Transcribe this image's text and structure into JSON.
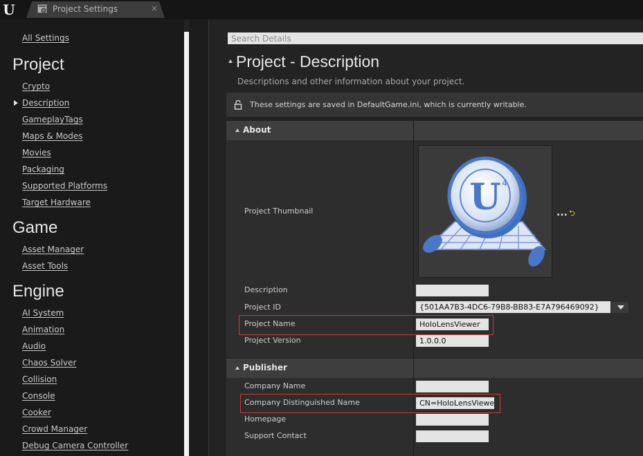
{
  "window": {
    "tab_title": "Project Settings",
    "tab_close": "×",
    "logo_text": "U"
  },
  "sidebar": {
    "all_settings": "All Settings",
    "sections": [
      {
        "heading": "Project",
        "items": [
          "Crypto",
          "Description",
          "GameplayTags",
          "Maps & Modes",
          "Movies",
          "Packaging",
          "Supported Platforms",
          "Target Hardware"
        ]
      },
      {
        "heading": "Game",
        "items": [
          "Asset Manager",
          "Asset Tools"
        ]
      },
      {
        "heading": "Engine",
        "items": [
          "AI System",
          "Animation",
          "Audio",
          "Chaos Solver",
          "Collision",
          "Console",
          "Cooker",
          "Crowd Manager",
          "Debug Camera Controller"
        ]
      }
    ],
    "selected_item": "Description"
  },
  "details": {
    "search_placeholder": "Search Details",
    "title": "Project - Description",
    "subtitle": "Descriptions and other information about your project.",
    "notice": "These settings are saved in DefaultGame.ini, which is currently writable.",
    "about": {
      "label": "About",
      "rows": {
        "thumbnail_label": "Project Thumbnail",
        "thumbnail_more": "...",
        "thumbnail_reset": "⮌",
        "description_label": "Description",
        "description_value": "",
        "project_id_label": "Project ID",
        "project_id_value": "{501AA7B3-4DC6-79B8-BB83-E7A796469092}",
        "project_name_label": "Project Name",
        "project_name_value": "HoloLensViewer",
        "project_version_label": "Project Version",
        "project_version_value": "1.0.0.0"
      }
    },
    "publisher": {
      "label": "Publisher",
      "rows": {
        "company_name_label": "Company Name",
        "company_name_value": "",
        "company_dn_label": "Company Distinguished Name",
        "company_dn_value": "CN=HoloLensViewer",
        "homepage_label": "Homepage",
        "homepage_value": "",
        "support_contact_label": "Support Contact",
        "support_contact_value": ""
      }
    }
  },
  "colors": {
    "highlight_border": "#cc3a3a",
    "reset_icon": "#e8d44d",
    "thumbnail_blue": "#4a78c8"
  },
  "icons": [
    "unreal-logo-icon",
    "settings-tab-icon",
    "lock-icon",
    "collapse-arrow-icon",
    "dropdown-arrow-icon",
    "reset-to-default-icon"
  ]
}
